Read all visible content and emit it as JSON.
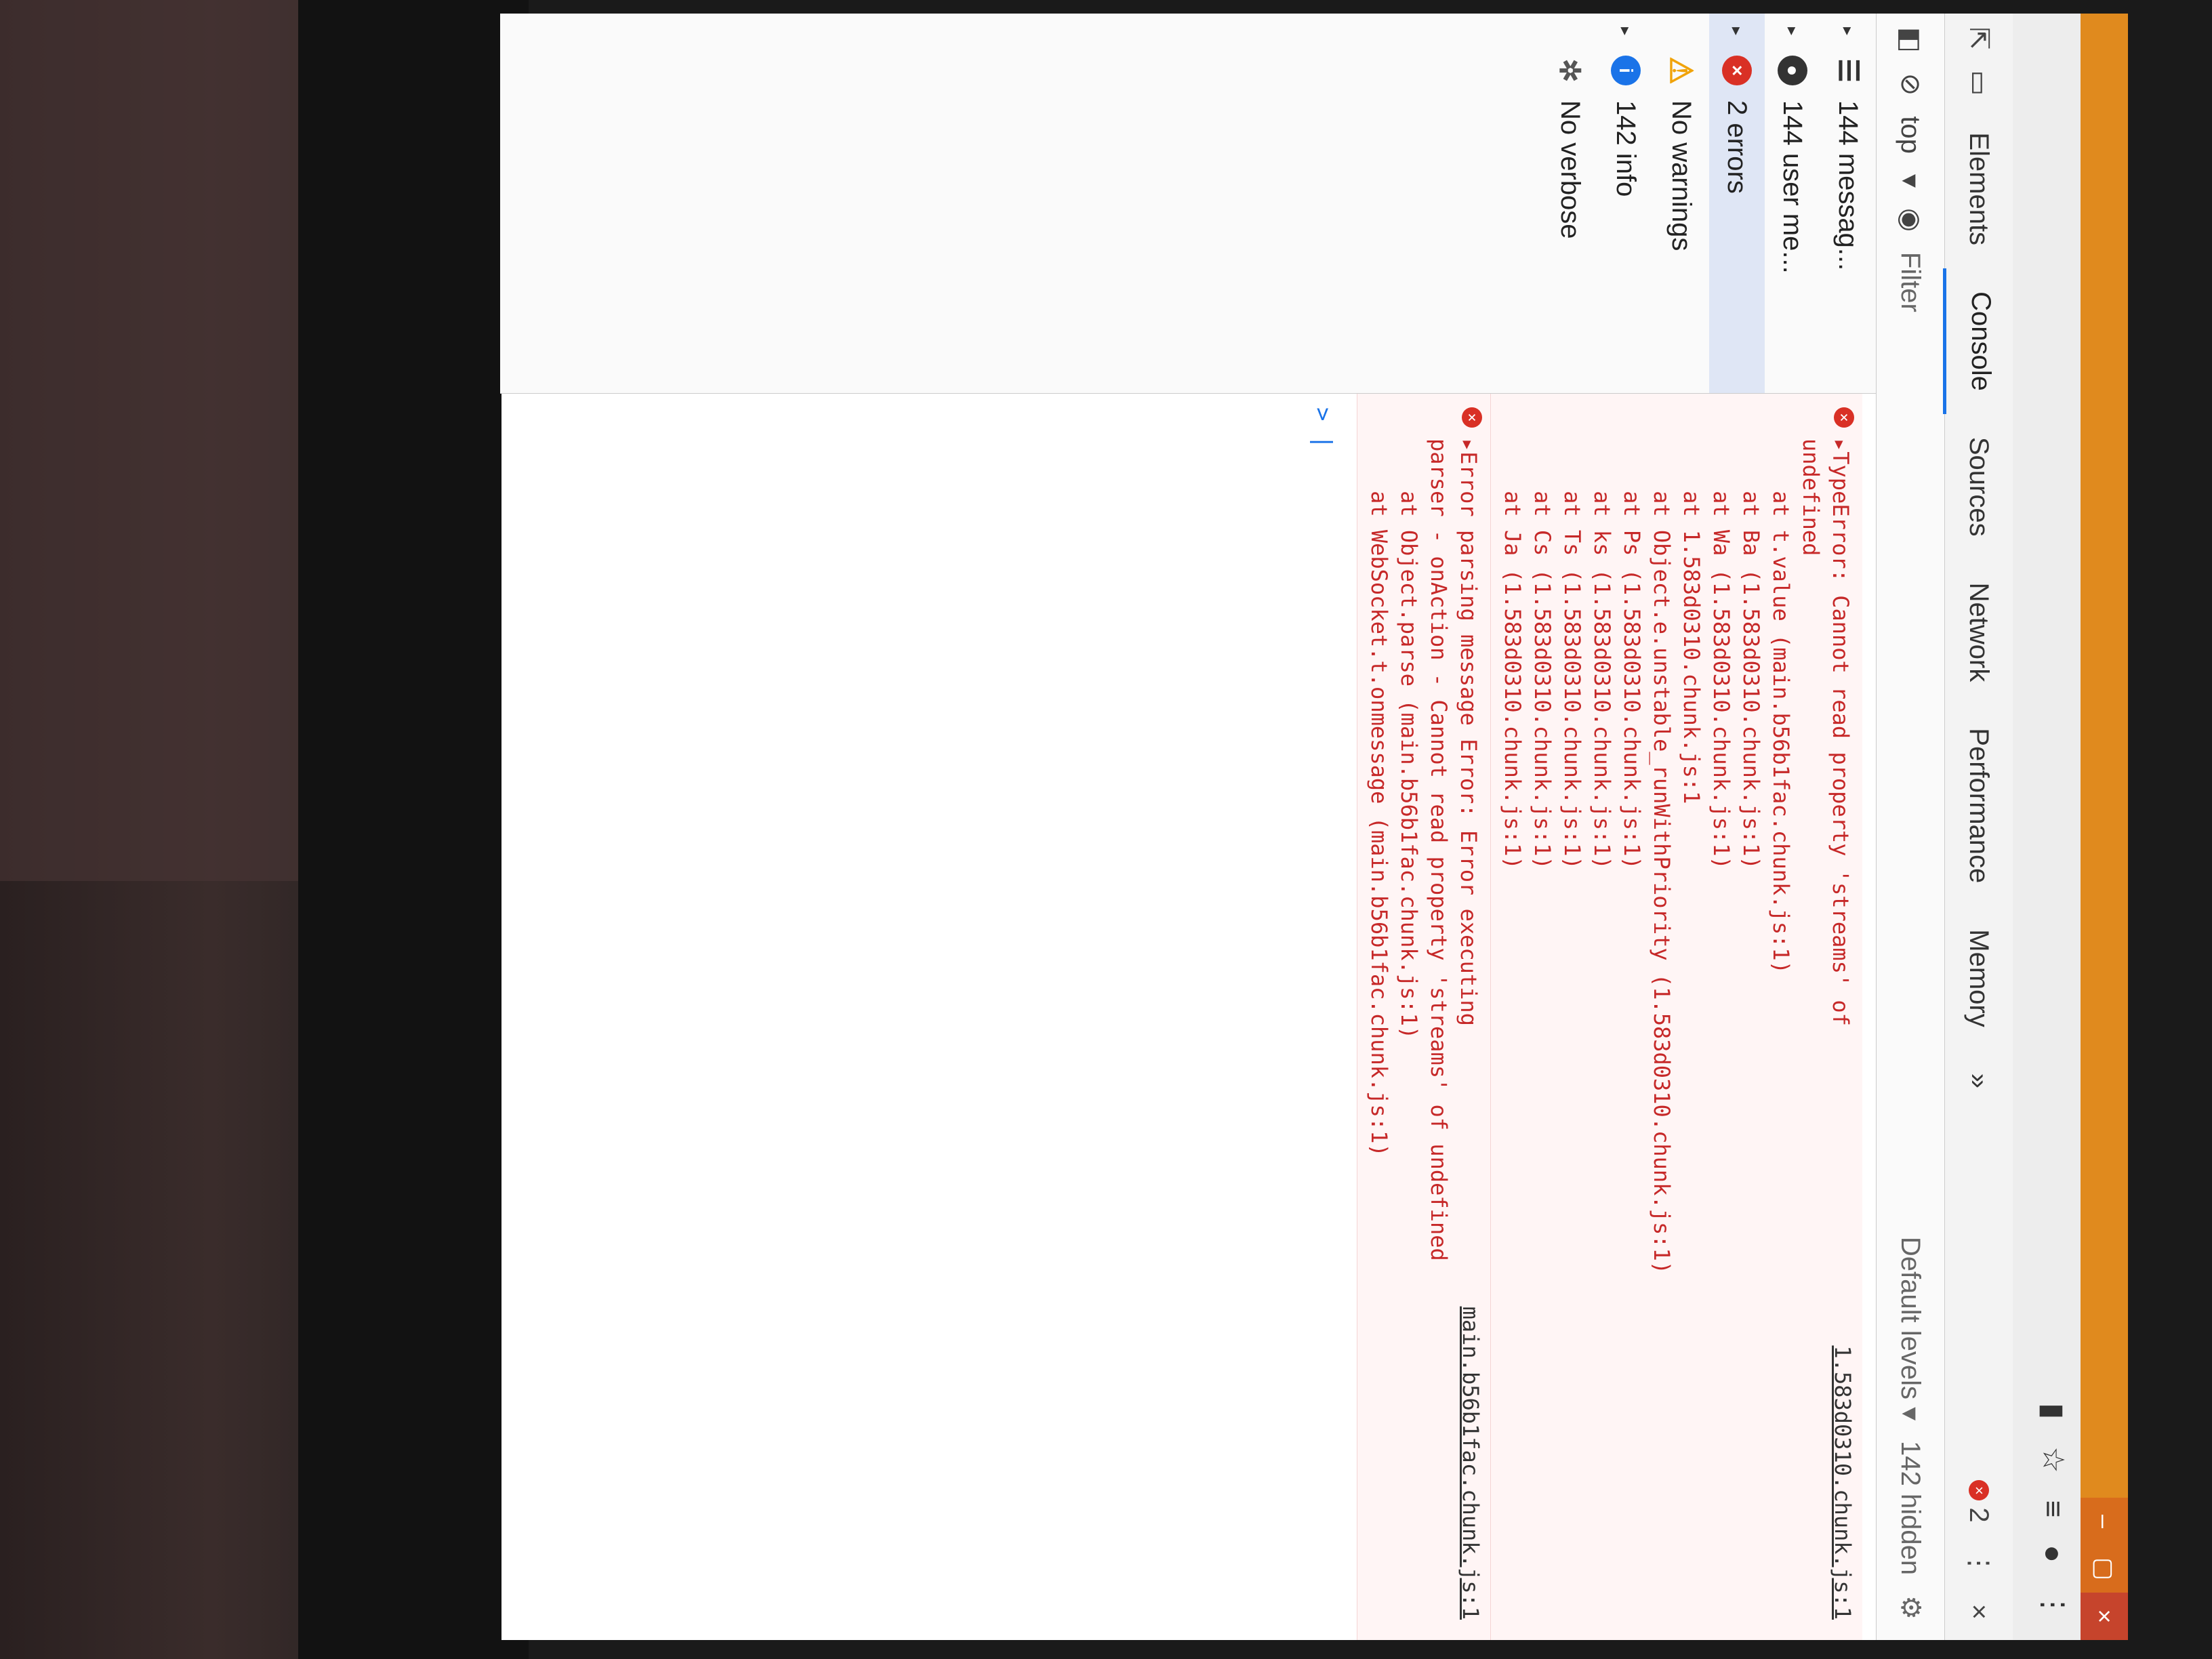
{
  "window": {
    "close_label": "×",
    "restore_label": "▢",
    "minimize_label": "–"
  },
  "browser_toolbar": {
    "more_label": "⋮"
  },
  "tabs": {
    "items": [
      "Elements",
      "Console",
      "Sources",
      "Network",
      "Performance",
      "Memory"
    ],
    "active": "Console",
    "overflow_label": "»",
    "error_count": "2",
    "more_label": "⋮",
    "close_label": "×"
  },
  "filterbar": {
    "context": "top",
    "filter_placeholder": "Filter",
    "levels_label": "Default levels ▾",
    "hidden_label": "142 hidden"
  },
  "sidebar": {
    "items": [
      {
        "label": "144 messag...",
        "icon": "list-icon",
        "has_arrow": true
      },
      {
        "label": "144 user me...",
        "icon": "user-icon",
        "has_arrow": true
      },
      {
        "label": "2 errors",
        "icon": "error-icon",
        "has_arrow": true
      },
      {
        "label": "No warnings",
        "icon": "warning-icon",
        "has_arrow": false
      },
      {
        "label": "142 info",
        "icon": "info-icon",
        "has_arrow": true
      },
      {
        "label": "No verbose",
        "icon": "verbose-icon",
        "has_arrow": false
      }
    ]
  },
  "console": {
    "messages": [
      {
        "head": "▸TypeError: Cannot read property 'streams' of",
        "source": "1.583d0310.chunk.js:1",
        "lines": [
          "undefined",
          "    at t.value (main.b56b1fac.chunk.js:1)",
          "    at Ba (1.583d0310.chunk.js:1)",
          "    at Wa (1.583d0310.chunk.js:1)",
          "    at 1.583d0310.chunk.js:1",
          "    at Object.e.unstable_runWithPriority (1.583d0310.chunk.js:1)",
          "    at Ps (1.583d0310.chunk.js:1)",
          "    at ks (1.583d0310.chunk.js:1)",
          "    at Ts (1.583d0310.chunk.js:1)",
          "    at Cs (1.583d0310.chunk.js:1)",
          "    at Ja (1.583d0310.chunk.js:1)"
        ]
      },
      {
        "head": "▸Error parsing message Error: Error executing",
        "source": "main.b56b1fac.chunk.js:1",
        "lines": [
          "parser - onAction - Cannot read property 'streams' of undefined",
          "    at Object.parse (main.b56b1fac.chunk.js:1)",
          "    at WebSocket.t.onmessage (main.b56b1fac.chunk.js:1)"
        ]
      }
    ],
    "prompt": ">"
  }
}
